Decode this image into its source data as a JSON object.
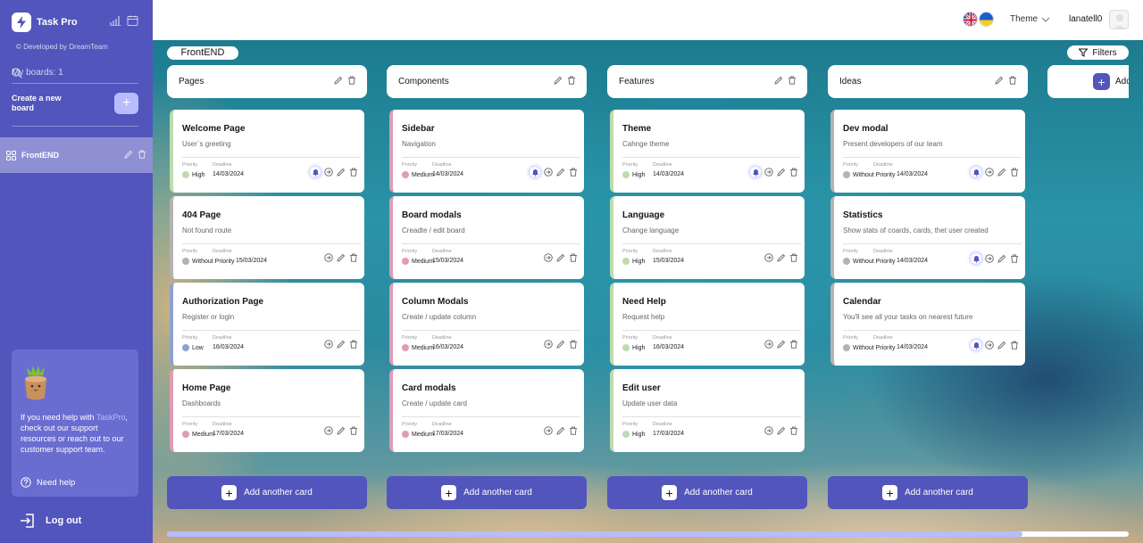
{
  "sidebar": {
    "app_name": "Task Pro",
    "credit": "© Developed by DreamTeam",
    "my_boards_label": "My boards: 1",
    "create_board_label": "Create a new board",
    "boards": [
      {
        "name": "FrontEND",
        "icon": "grid-icon"
      }
    ],
    "help_text_pre": "If you need help with ",
    "help_text_link": "TaskPro",
    "help_text_post": ", check out our support resources or reach out to our customer support team.",
    "need_help_label": "Need help",
    "logout_label": "Log out",
    "colors": {
      "background": "#5255bc",
      "accent": "#b8bcfd"
    }
  },
  "header": {
    "theme_label": "Theme",
    "user_name": "lanatell0"
  },
  "board": {
    "title": "FrontEND",
    "filters_label": "Filters",
    "add_column_label": "Add another column",
    "add_card_label": "Add another card",
    "priority_label": "Priority",
    "deadline_label": "Deadline",
    "priority_colors": {
      "High": "#bedbb0",
      "Medium": "#e09cb5",
      "Low": "#8fa1d0",
      "Without Priority": "#b3b3b3"
    },
    "columns": [
      {
        "title": "Pages",
        "cards": [
          {
            "title": "Welcome Page",
            "desc": "User`s greeting",
            "priority": "High",
            "deadline": "14/03/2024",
            "bell": true
          },
          {
            "title": "404 Page",
            "desc": "Not found route",
            "priority": "Without Priority",
            "deadline": "15/03/2024",
            "bell": false
          },
          {
            "title": "Authorization Page",
            "desc": "Register or login",
            "priority": "Low",
            "deadline": "16/03/2024",
            "bell": false
          },
          {
            "title": "Home Page",
            "desc": "Dashboards",
            "priority": "Medium",
            "deadline": "17/03/2024",
            "bell": false
          }
        ]
      },
      {
        "title": "Components",
        "cards": [
          {
            "title": "Sidebar",
            "desc": "Navigation",
            "priority": "Medium",
            "deadline": "14/03/2024",
            "bell": true
          },
          {
            "title": "Board modals",
            "desc": "Creadte / edit board",
            "priority": "Medium",
            "deadline": "15/03/2024",
            "bell": false
          },
          {
            "title": "Column Modals",
            "desc": "Create / update column",
            "priority": "Medium",
            "deadline": "16/03/2024",
            "bell": false
          },
          {
            "title": "Card modals",
            "desc": "Create / update card",
            "priority": "Medium",
            "deadline": "17/03/2024",
            "bell": false
          }
        ]
      },
      {
        "title": "Features",
        "cards": [
          {
            "title": "Theme",
            "desc": "Cahnge theme",
            "priority": "High",
            "deadline": "14/03/2024",
            "bell": true
          },
          {
            "title": "Language",
            "desc": "Change language",
            "priority": "High",
            "deadline": "15/03/2024",
            "bell": false
          },
          {
            "title": "Need Help",
            "desc": "Request help",
            "priority": "High",
            "deadline": "16/03/2024",
            "bell": false
          },
          {
            "title": "Edit user",
            "desc": "Update user data",
            "priority": "High",
            "deadline": "17/03/2024",
            "bell": false
          }
        ]
      },
      {
        "title": "Ideas",
        "cards": [
          {
            "title": "Dev modal",
            "desc": "Present developers of our team",
            "priority": "Without Priority",
            "deadline": "14/03/2024",
            "bell": true
          },
          {
            "title": "Statistics",
            "desc": "Show stats of coards, cards, thet user created",
            "priority": "Without Priority",
            "deadline": "14/03/2024",
            "bell": true
          },
          {
            "title": "Calendar",
            "desc": "You'll see all your tasks on nearest future",
            "priority": "Without Priority",
            "deadline": "14/03/2024",
            "bell": true
          }
        ]
      }
    ]
  }
}
